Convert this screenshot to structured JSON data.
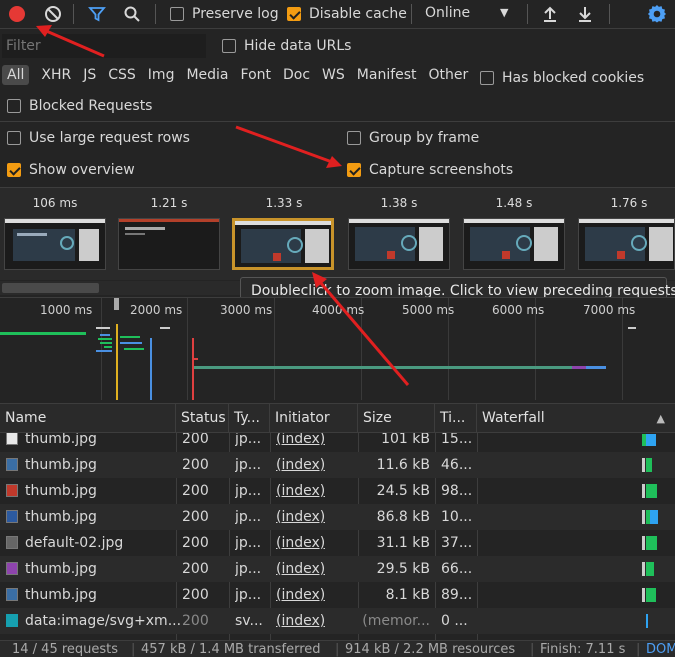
{
  "toolbar": {
    "preserve_log": "Preserve log",
    "disable_cache": "Disable cache",
    "throttle": "Online"
  },
  "filter_row": {
    "placeholder": "Filter",
    "hide_data_urls": "Hide data URLs"
  },
  "type_filters": [
    "All",
    "XHR",
    "JS",
    "CSS",
    "Img",
    "Media",
    "Font",
    "Doc",
    "WS",
    "Manifest",
    "Other"
  ],
  "has_blocked_cookies": "Has blocked cookies",
  "blocked_requests": "Blocked Requests",
  "settings": {
    "large_rows": "Use large request rows",
    "group_by_frame": "Group by frame",
    "show_overview": "Show overview",
    "capture_screenshots": "Capture screenshots"
  },
  "screenshots": [
    "106 ms",
    "1.21 s",
    "1.33 s",
    "1.38 s",
    "1.48 s",
    "1.76 s"
  ],
  "tooltip": "Doubleclick to zoom image. Click to view preceding requests.",
  "timeline_ticks": [
    "1000 ms",
    "2000 ms",
    "3000 ms",
    "4000 ms",
    "5000 ms",
    "6000 ms",
    "7000 ms"
  ],
  "columns": {
    "name": "Name",
    "status": "Status",
    "type": "Ty...",
    "initiator": "Initiator",
    "size": "Size",
    "time": "Ti...",
    "waterfall": "Waterfall"
  },
  "rows": [
    {
      "name": "thumb.jpg",
      "status": "200",
      "type": "jp...",
      "initiator": "(index)",
      "size": "101 kB",
      "time": "15..."
    },
    {
      "name": "thumb.jpg",
      "status": "200",
      "type": "jp...",
      "initiator": "(index)",
      "size": "11.6 kB",
      "time": "46..."
    },
    {
      "name": "thumb.jpg",
      "status": "200",
      "type": "jp...",
      "initiator": "(index)",
      "size": "24.5 kB",
      "time": "98..."
    },
    {
      "name": "thumb.jpg",
      "status": "200",
      "type": "jp...",
      "initiator": "(index)",
      "size": "86.8 kB",
      "time": "10..."
    },
    {
      "name": "default-02.jpg",
      "status": "200",
      "type": "jp...",
      "initiator": "(index)",
      "size": "31.1 kB",
      "time": "37..."
    },
    {
      "name": "thumb.jpg",
      "status": "200",
      "type": "jp...",
      "initiator": "(index)",
      "size": "29.5 kB",
      "time": "66..."
    },
    {
      "name": "thumb.jpg",
      "status": "200",
      "type": "jp...",
      "initiator": "(index)",
      "size": "8.1 kB",
      "time": "89..."
    },
    {
      "name": "data:image/svg+xm...",
      "status": "200",
      "type": "sv...",
      "initiator": "(index)",
      "size": "(memor...",
      "time": "0 ..."
    }
  ],
  "status_bar": {
    "requests": "14 / 45 requests",
    "transferred": "457 kB / 1.4 MB transferred",
    "resources": "914 kB / 2.2 MB resources",
    "finish": "Finish: 7.11 s",
    "dom": "DOM"
  },
  "colors": {
    "record": "#e53935",
    "accent": "#f39c12",
    "link_blue": "#4d9ff5",
    "annotation": "#e02020"
  }
}
